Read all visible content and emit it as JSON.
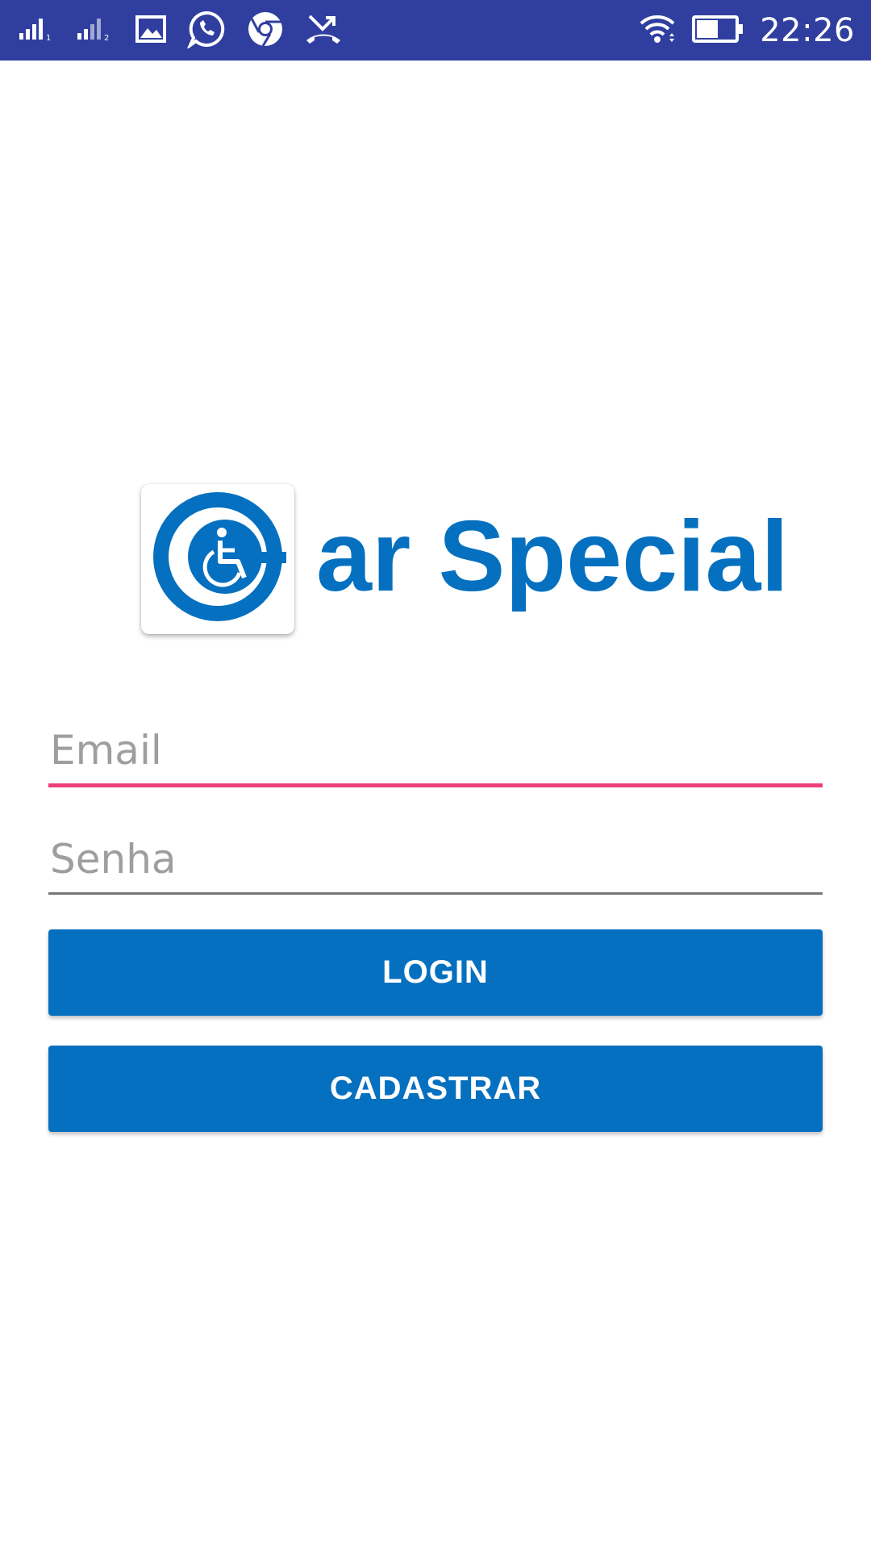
{
  "status_bar": {
    "time": "22:26",
    "left_icons": [
      "signal-sim1-icon",
      "signal-sim2-icon",
      "gallery-icon",
      "whatsapp-icon",
      "chrome-icon",
      "missed-call-icon"
    ],
    "right_icons": [
      "wifi-icon",
      "battery-icon"
    ],
    "color": "#303f9f"
  },
  "brand": {
    "logo_icon": "wheelchair-icon",
    "logo_text": "ar Special",
    "color": "#0570bf"
  },
  "form": {
    "email_placeholder": "Email",
    "password_placeholder": "Senha",
    "focus_color": "#ec407a",
    "login_label": "LOGIN",
    "register_label": "CADASTRAR"
  }
}
